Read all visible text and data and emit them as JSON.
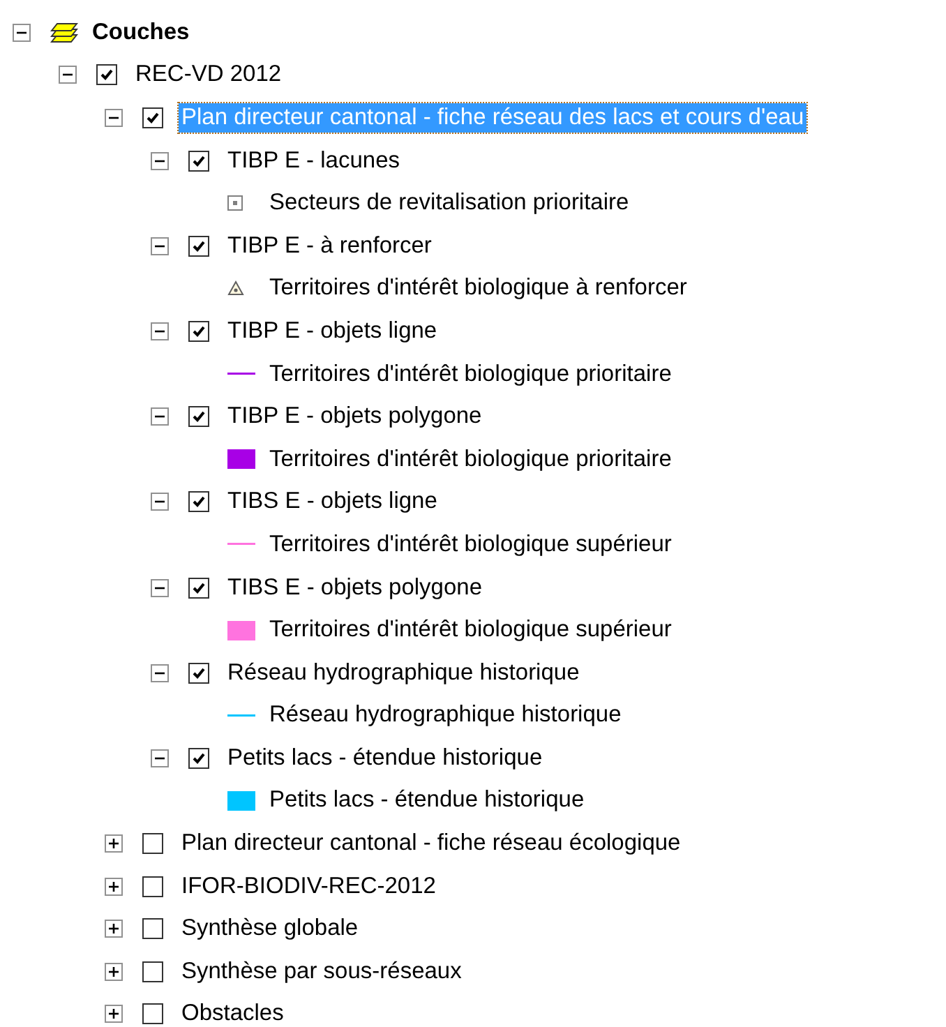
{
  "tree": {
    "label": "Couches",
    "expanded": true,
    "children": [
      {
        "label": "REC-VD 2012",
        "checked": true,
        "expanded": true,
        "selected": false,
        "children": [
          {
            "label": "Plan directeur cantonal - fiche réseau des lacs et cours d'eau",
            "checked": true,
            "expanded": true,
            "selected": true,
            "children": [
              {
                "label": "TIBP E - lacunes",
                "checked": true,
                "expanded": true,
                "selected": false,
                "children": [
                  {
                    "kind": "dot-square",
                    "color": "#808080",
                    "label": "Secteurs de revitalisation prioritaire"
                  }
                ]
              },
              {
                "label": "TIBP E - à renforcer",
                "checked": true,
                "expanded": true,
                "selected": false,
                "children": [
                  {
                    "kind": "triangle",
                    "color": "#606060",
                    "label": "Territoires d'intérêt biologique à renforcer"
                  }
                ]
              },
              {
                "label": "TIBP E - objets ligne",
                "checked": true,
                "expanded": true,
                "selected": false,
                "children": [
                  {
                    "kind": "line",
                    "color": "#a800e6",
                    "label": "Territoires d'intérêt biologique prioritaire"
                  }
                ]
              },
              {
                "label": "TIBP E - objets polygone",
                "checked": true,
                "expanded": true,
                "selected": false,
                "children": [
                  {
                    "kind": "fill",
                    "color": "#a800e6",
                    "label": "Territoires d'intérêt biologique prioritaire"
                  }
                ]
              },
              {
                "label": "TIBS E - objets ligne",
                "checked": true,
                "expanded": true,
                "selected": false,
                "children": [
                  {
                    "kind": "line",
                    "color": "#ff73df",
                    "label": "Territoires d'intérêt biologique supérieur"
                  }
                ]
              },
              {
                "label": "TIBS E - objets polygone",
                "checked": true,
                "expanded": true,
                "selected": false,
                "children": [
                  {
                    "kind": "fill",
                    "color": "#ff73df",
                    "label": "Territoires d'intérêt biologique supérieur"
                  }
                ]
              },
              {
                "label": "Réseau hydrographique historique",
                "checked": true,
                "expanded": true,
                "selected": false,
                "children": [
                  {
                    "kind": "line",
                    "color": "#00c5ff",
                    "label": "Réseau hydrographique historique"
                  }
                ]
              },
              {
                "label": "Petits lacs - étendue historique",
                "checked": true,
                "expanded": true,
                "selected": false,
                "children": [
                  {
                    "kind": "fill",
                    "color": "#00c5ff",
                    "label": "Petits lacs - étendue historique"
                  }
                ]
              }
            ]
          },
          {
            "label": "Plan directeur cantonal - fiche réseau écologique",
            "checked": false,
            "expanded": false,
            "selected": false
          },
          {
            "label": "IFOR-BIODIV-REC-2012",
            "checked": false,
            "expanded": false,
            "selected": false
          },
          {
            "label": "Synthèse globale",
            "checked": false,
            "expanded": false,
            "selected": false
          },
          {
            "label": "Synthèse par sous-réseaux",
            "checked": false,
            "expanded": false,
            "selected": false
          },
          {
            "label": "Obstacles",
            "checked": false,
            "expanded": false,
            "selected": false
          }
        ]
      }
    ]
  }
}
